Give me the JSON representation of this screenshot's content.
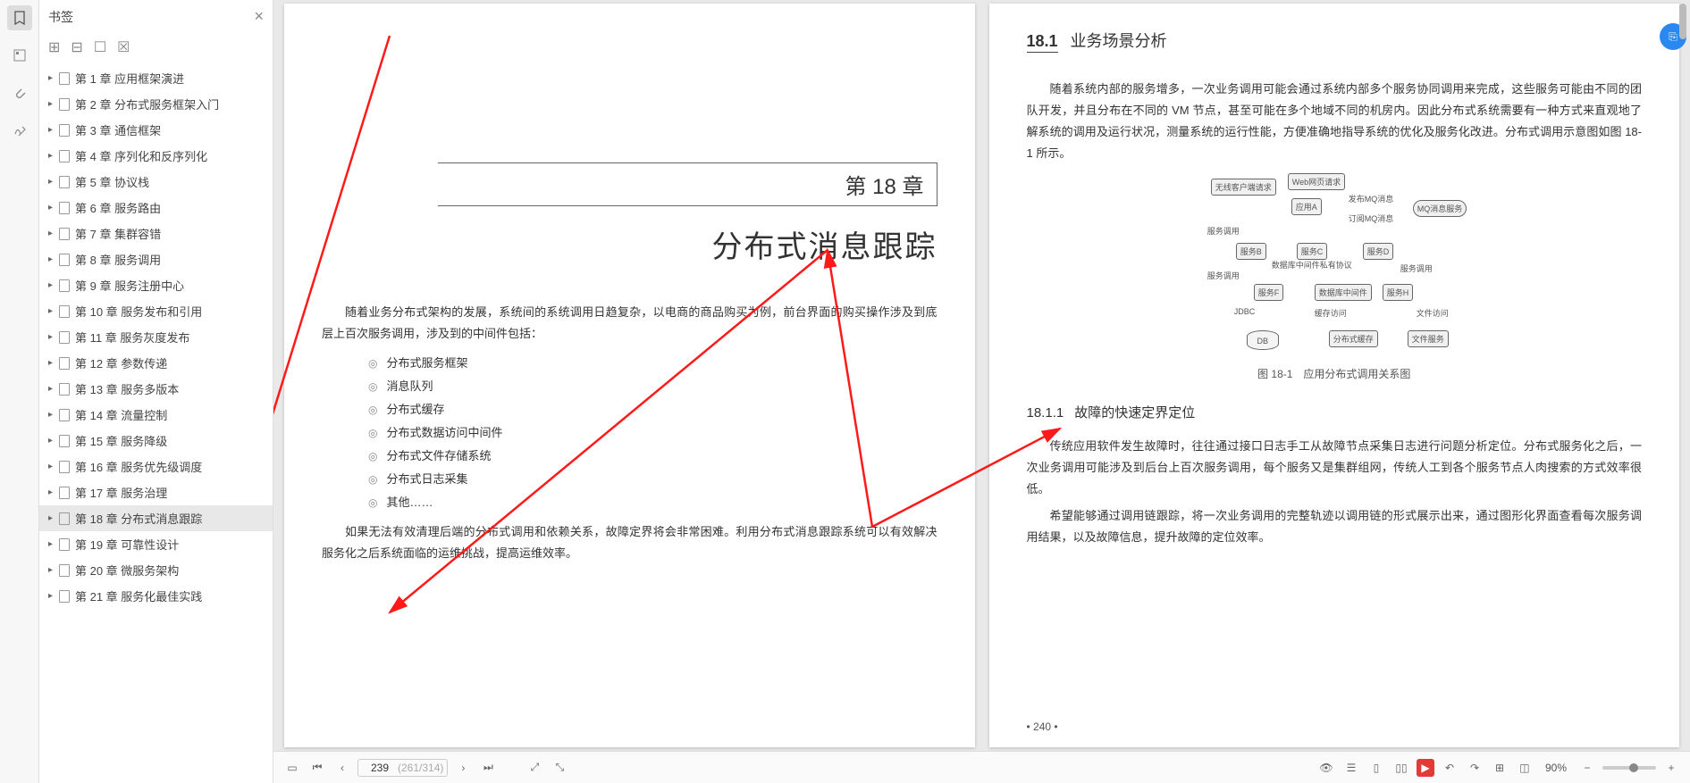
{
  "sidebar_rail": {
    "items": [
      {
        "name": "bookmark-icon",
        "active": true
      },
      {
        "name": "thumbnail-icon",
        "active": false
      },
      {
        "name": "attachment-icon",
        "active": false
      },
      {
        "name": "signature-icon",
        "active": false
      }
    ]
  },
  "bookmark_panel": {
    "title": "书签",
    "close": "×",
    "tools": [
      "add-bookmark-icon",
      "add-folder-icon",
      "bookmark-flag-icon",
      "bookmark-outline-icon"
    ],
    "items": [
      {
        "label": "第 1 章 应用框架演进"
      },
      {
        "label": "第 2 章 分布式服务框架入门"
      },
      {
        "label": "第 3 章 通信框架"
      },
      {
        "label": "第 4 章 序列化和反序列化"
      },
      {
        "label": "第 5 章 协议栈"
      },
      {
        "label": "第 6 章 服务路由"
      },
      {
        "label": "第 7 章 集群容错"
      },
      {
        "label": "第 8 章 服务调用"
      },
      {
        "label": "第 9 章 服务注册中心"
      },
      {
        "label": "第 10 章 服务发布和引用"
      },
      {
        "label": "第 11 章 服务灰度发布"
      },
      {
        "label": "第 12 章 参数传递"
      },
      {
        "label": "第 13 章 服务多版本"
      },
      {
        "label": "第 14 章 流量控制"
      },
      {
        "label": "第 15 章 服务降级"
      },
      {
        "label": "第 16 章 服务优先级调度"
      },
      {
        "label": "第 17 章 服务治理"
      },
      {
        "label": "第 18 章 分布式消息跟踪",
        "selected": true
      },
      {
        "label": "第 19 章 可靠性设计"
      },
      {
        "label": "第 20 章 微服务架构"
      },
      {
        "label": "第 21 章 服务化最佳实践"
      }
    ]
  },
  "page_left": {
    "chapter_num": "第 18 章",
    "chapter_title": "分布式消息跟踪",
    "p1": "随着业务分布式架构的发展，系统间的系统调用日趋复杂，以电商的商品购买为例，前台界面的购买操作涉及到底层上百次服务调用，涉及到的中间件包括：",
    "bullets": [
      "分布式服务框架",
      "消息队列",
      "分布式缓存",
      "分布式数据访问中间件",
      "分布式文件存储系统",
      "分布式日志采集",
      "其他……"
    ],
    "p2": "如果无法有效清理后端的分布式调用和依赖关系，故障定界将会非常困难。利用分布式消息跟踪系统可以有效解决服务化之后系统面临的运维挑战，提高运维效率。"
  },
  "page_right": {
    "h2_num": "18.1",
    "h2_title": "业务场景分析",
    "p1": "随着系统内部的服务增多，一次业务调用可能会通过系统内部多个服务协同调用来完成，这些服务可能由不同的团队开发，并且分布在不同的 VM 节点，甚至可能在多个地域不同的机房内。因此分布式系统需要有一种方式来直观地了解系统的调用及运行状况，测量系统的运行性能，方便准确地指导系统的优化及服务化改进。分布式调用示意图如图 18-1 所示。",
    "fig_caption": "图 18-1　应用分布式调用关系图",
    "fig_nodes": {
      "client": "无线客户端请求",
      "web": "Web网页请求",
      "appa": "应用A",
      "pubmq": "发布MQ消息",
      "mqserv": "MQ消息服务",
      "submq": "订阅MQ消息",
      "call1": "服务调用",
      "svcb": "服务B",
      "svcc": "服务C",
      "svcd": "服务D",
      "dbmid": "数据库中间件私有协议",
      "call2": "服务调用",
      "call3": "服务调用",
      "svcf": "服务F",
      "dbm": "数据库中间件",
      "svch": "服务H",
      "jdbc": "JDBC",
      "cache": "缓存访问",
      "file": "文件访问",
      "db": "DB",
      "dist": "分布式缓存",
      "fs": "文件服务"
    },
    "h3_num": "18.1.1",
    "h3_title": "故障的快速定界定位",
    "p2": "传统应用软件发生故障时，往往通过接口日志手工从故障节点采集日志进行问题分析定位。分布式服务化之后，一次业务调用可能涉及到后台上百次服务调用，每个服务又是集群组网，传统人工到各个服务节点人肉搜索的方式效率很低。",
    "p3": "希望能够通过调用链跟踪，将一次业务调用的完整轨迹以调用链的形式展示出来，通过图形化界面查看每次服务调用结果，以及故障信息，提升故障的定位效率。",
    "page_num": "• 240 •"
  },
  "statusbar": {
    "page_current": "239",
    "page_frac": "(261/314)",
    "zoom": "90%"
  },
  "floating_badge": "⎘"
}
